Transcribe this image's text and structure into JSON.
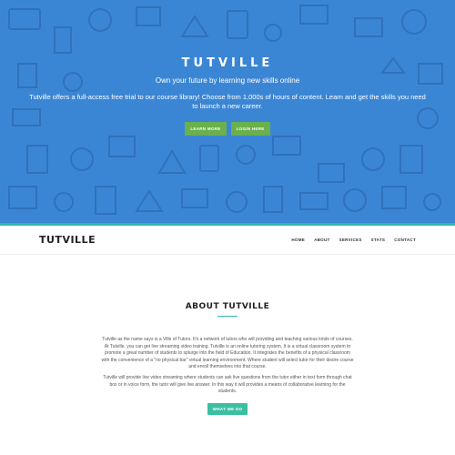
{
  "hero": {
    "title": "TUTVILLE",
    "tagline": "Own your future by learning new skills online",
    "description": "Tutville offers a full-access free trial to our course library! Choose from 1,000s of hours of content. Learn and get the skills you need to launch a new career.",
    "learn_more_label": "LEARN MORE",
    "login_label": "LOGIN HERE",
    "background_color": "#3b86d4",
    "button_color": "#6ab04c",
    "accent_color": "#2bb9b0"
  },
  "navbar": {
    "brand": "TUTVILLE",
    "links": [
      "HOME",
      "ABOUT",
      "SERVICES",
      "STATS",
      "CONTACT"
    ]
  },
  "about": {
    "title": "ABOUT TUTVILLE",
    "paragraph1": "Tutville as the name says is a Ville of Tutors. It's a network of tutors who will providing and teaching various kinds of courses. At Tutville, you can get live streaming video training. Tutville is an online tutoring system. It is a virtual classroom system to promote a great number of students to splurge into the field of Education. It integrates the benefits of a physical classroom with the convenience of a \"no physical bar\" virtual learning environment. Where student will select tutor for their desire course and enroll themselves into that course.",
    "paragraph2": "Tutville will provide live video streaming where students can ask live questions from the tutor either in text form through chat box or in voice form, the tutor will give live answer. In this way it will provides a means of collaborative learning for the students.",
    "button_label": "WHAT WE DO",
    "button_color": "#3bbfa0"
  }
}
